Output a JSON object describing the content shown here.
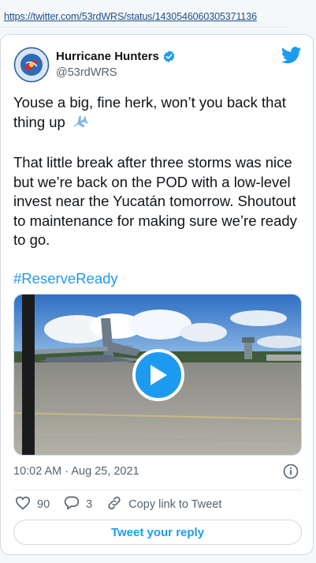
{
  "url": "https://twitter.com/53rdWRS/status/1430546060305371136",
  "tweet": {
    "author": {
      "display_name": "Hurricane Hunters",
      "handle": "@53rdWRS",
      "verified": true,
      "avatar": "53rd-wrs-squadron-patch"
    },
    "text_line1": "Youse a big, fine herk, won’t you back that thing up",
    "text_emoji": "airplane",
    "text_para2": "That little break after three storms was nice but we’re back on the POD with a low-level invest near the Yucatán tomorrow. Shoutout to maintenance for making sure we’re ready to go.",
    "hashtag": "#ReserveReady",
    "media": {
      "type": "video",
      "thumbnail": "c130-aircraft-on-flight-line",
      "icon": "play-icon"
    },
    "timestamp": "10:02 AM · Aug 25, 2021",
    "likes": "90",
    "replies": "3",
    "copy_link_label": "Copy link to Tweet",
    "reply_button_label": "Tweet your reply"
  },
  "colors": {
    "accent": "#1d9bf0",
    "link": "#1b4f8a",
    "secondary_text": "#536471",
    "primary_text": "#0f1419",
    "border": "#cfd9de"
  }
}
